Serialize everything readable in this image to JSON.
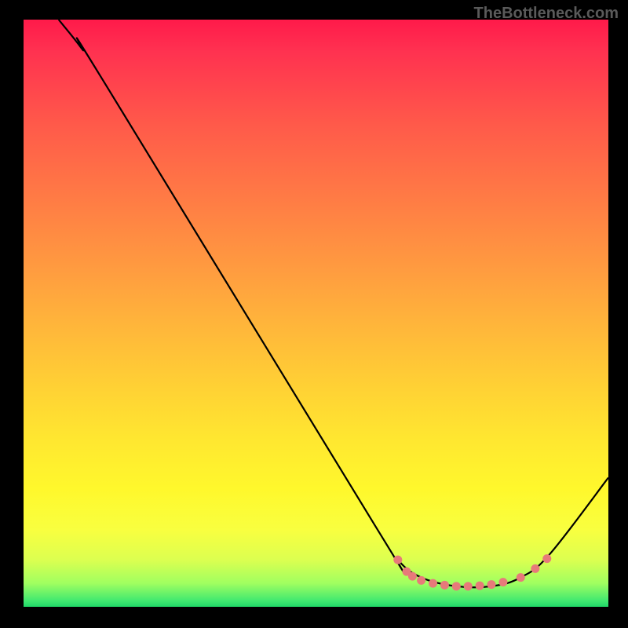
{
  "watermark": "TheBottleneck.com",
  "chart_data": {
    "type": "line",
    "title": "",
    "xlabel": "",
    "ylabel": "",
    "xlim": [
      0,
      100
    ],
    "ylim": [
      0,
      100
    ],
    "curve": [
      {
        "x": 6,
        "y": 100
      },
      {
        "x": 10,
        "y": 95
      },
      {
        "x": 14,
        "y": 89
      },
      {
        "x": 60,
        "y": 14
      },
      {
        "x": 64,
        "y": 8
      },
      {
        "x": 68,
        "y": 5
      },
      {
        "x": 74,
        "y": 3.5
      },
      {
        "x": 80,
        "y": 3.5
      },
      {
        "x": 85,
        "y": 5
      },
      {
        "x": 90,
        "y": 9
      },
      {
        "x": 100,
        "y": 22
      }
    ],
    "dots": [
      {
        "x": 64,
        "y": 8
      },
      {
        "x": 65.5,
        "y": 6
      },
      {
        "x": 66.5,
        "y": 5.2
      },
      {
        "x": 68,
        "y": 4.5
      },
      {
        "x": 70,
        "y": 4
      },
      {
        "x": 72,
        "y": 3.7
      },
      {
        "x": 74,
        "y": 3.5
      },
      {
        "x": 76,
        "y": 3.5
      },
      {
        "x": 78,
        "y": 3.6
      },
      {
        "x": 80,
        "y": 3.8
      },
      {
        "x": 82,
        "y": 4.2
      },
      {
        "x": 85,
        "y": 5
      },
      {
        "x": 87.5,
        "y": 6.5
      },
      {
        "x": 89.5,
        "y": 8.2
      }
    ],
    "gradient_note": "Vertical gradient red (top) through orange/yellow to green (bottom) representing bottleneck severity heatmap background"
  }
}
